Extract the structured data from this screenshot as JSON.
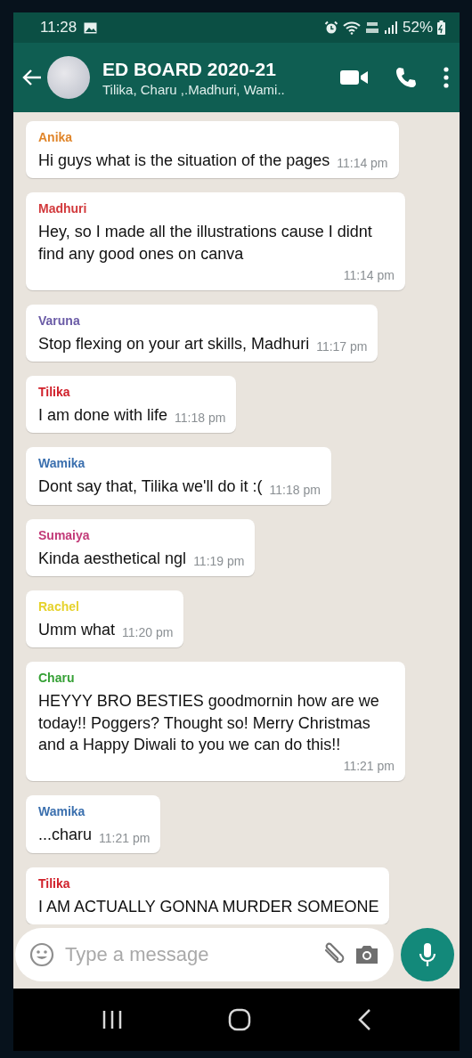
{
  "status_bar": {
    "time": "11:28",
    "battery": "52%"
  },
  "header": {
    "title": "ED BOARD 2020-21",
    "subtitle": "Tilika, Charu ,.Madhuri, Wami.."
  },
  "messages": [
    {
      "sender": "Anika",
      "color": "#e0852a",
      "text": "Hi guys what is the situation of the pages",
      "time": "11:14 pm"
    },
    {
      "sender": "Madhuri",
      "color": "#d2393c",
      "text": "Hey, so I made all the illustrations cause I didnt find any good ones on canva",
      "time": "11:14 pm"
    },
    {
      "sender": "Varuna",
      "color": "#6a5ba6",
      "text": "Stop flexing on your art skills, Madhuri",
      "time": "11:17 pm"
    },
    {
      "sender": "Tilika",
      "color": "#d0202a",
      "text": "I am done with life",
      "time": "11:18 pm"
    },
    {
      "sender": "Wamika",
      "color": "#3a6fae",
      "text": "Dont say that, Tilika we'll do it :(",
      "time": "11:18 pm"
    },
    {
      "sender": "Sumaiya",
      "color": "#c23a78",
      "text": "Kinda aesthetical ngl",
      "time": "11:19 pm"
    },
    {
      "sender": "Rachel",
      "color": "#e6d22c",
      "text": "Umm what",
      "time": "11:20 pm"
    },
    {
      "sender": "Charu",
      "color": "#35a035",
      "text": "HEYYY BRO BESTIES goodmornin how are we today!! Poggers? Thought so! Merry Christmas and a Happy Diwali to you we can do this!!",
      "time": "11:21 pm"
    },
    {
      "sender": "Wamika",
      "color": "#3a6fae",
      "text": "...charu",
      "time": "11:21 pm"
    },
    {
      "sender": "Tilika",
      "color": "#d0202a",
      "text": "I AM ACTUALLY GONNA MURDER SOMEONE"
    }
  ],
  "composer": {
    "placeholder": "Type a message"
  }
}
